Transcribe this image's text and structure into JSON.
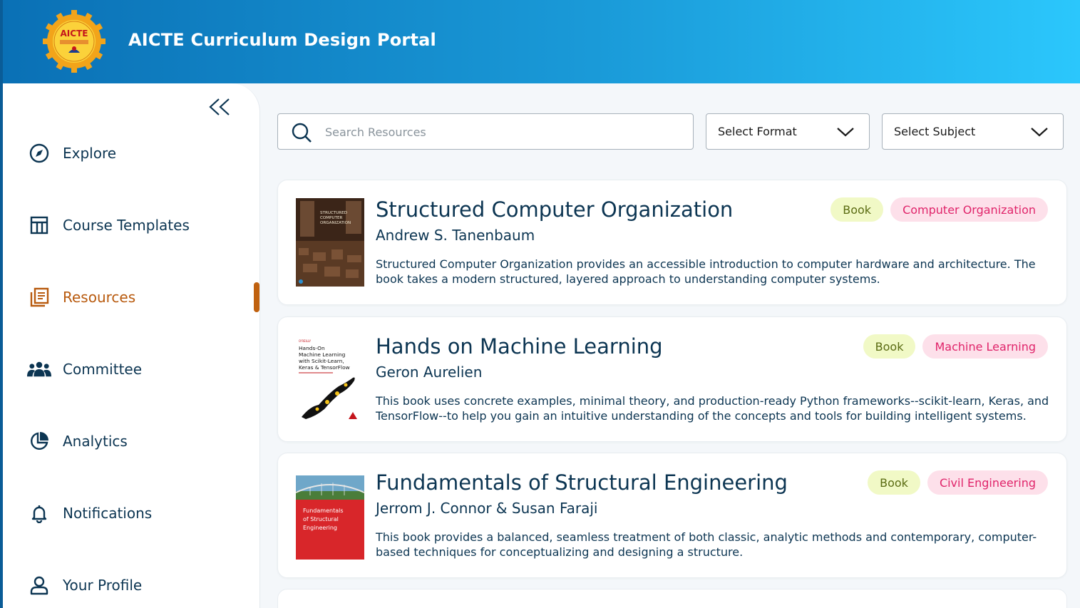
{
  "colors": {
    "header_gradient_start": "#0a70b5",
    "header_gradient_end": "#2bc7fc",
    "primary_text": "#0c3552",
    "active_accent": "#c0610f",
    "format_tag_bg": "#f1f9c6",
    "format_tag_text": "#5a6b12",
    "subject_tag_bg": "#fde0ea",
    "subject_tag_text": "#e0246a"
  },
  "header": {
    "title": "AICTE Curriculum Design Portal",
    "logo_text": "AICTE",
    "logo_icon": "aicte-gear-logo"
  },
  "sidebar": {
    "collapse_icon": "double-chevron-left-icon",
    "items": [
      {
        "label": "Explore",
        "icon": "compass-icon",
        "active": false
      },
      {
        "label": "Course Templates",
        "icon": "table-icon",
        "active": false
      },
      {
        "label": "Resources",
        "icon": "library-books-icon",
        "active": true
      },
      {
        "label": "Committee",
        "icon": "group-icon",
        "active": false
      },
      {
        "label": "Analytics",
        "icon": "pie-chart-icon",
        "active": false
      },
      {
        "label": "Notifications",
        "icon": "bell-icon",
        "active": false
      },
      {
        "label": "Your Profile",
        "icon": "user-icon",
        "active": false
      }
    ]
  },
  "filters": {
    "search_placeholder": "Search Resources",
    "search_value": "",
    "format_select": "Select Format",
    "subject_select": "Select Subject"
  },
  "resources": [
    {
      "title": "Structured Computer Organization",
      "author": "Andrew S. Tanenbaum",
      "description": "Structured Computer Organization provides an accessible introduction to computer hardware and architecture. The book takes a modern structured, layered approach to understanding computer systems.",
      "format": "Book",
      "subject": "Computer Organization",
      "cover_text": "STRUCTURED COMPUTER ORGANIZATION"
    },
    {
      "title": "Hands on Machine Learning",
      "author": "Geron Aurelien",
      "description": "This book uses concrete examples, minimal theory, and production-ready Python frameworks--scikit-learn, Keras, and TensorFlow--to help you gain an intuitive understanding of the concepts and tools for building intelligent systems.",
      "format": "Book",
      "subject": "Machine Learning",
      "cover_text": "Hands-On Machine Learning with Scikit-Learn, Keras & TensorFlow"
    },
    {
      "title": "Fundamentals of Structural Engineering",
      "author": "Jerrom J. Connor &  Susan Faraji",
      "description": "This book provides a balanced, seamless treatment of both classic, analytic methods and contemporary, computer-based techniques for conceptualizing and designing a structure.",
      "format": "Book",
      "subject": "Civil Engineering",
      "cover_text": "Fundamentals of Structural Engineering"
    }
  ]
}
